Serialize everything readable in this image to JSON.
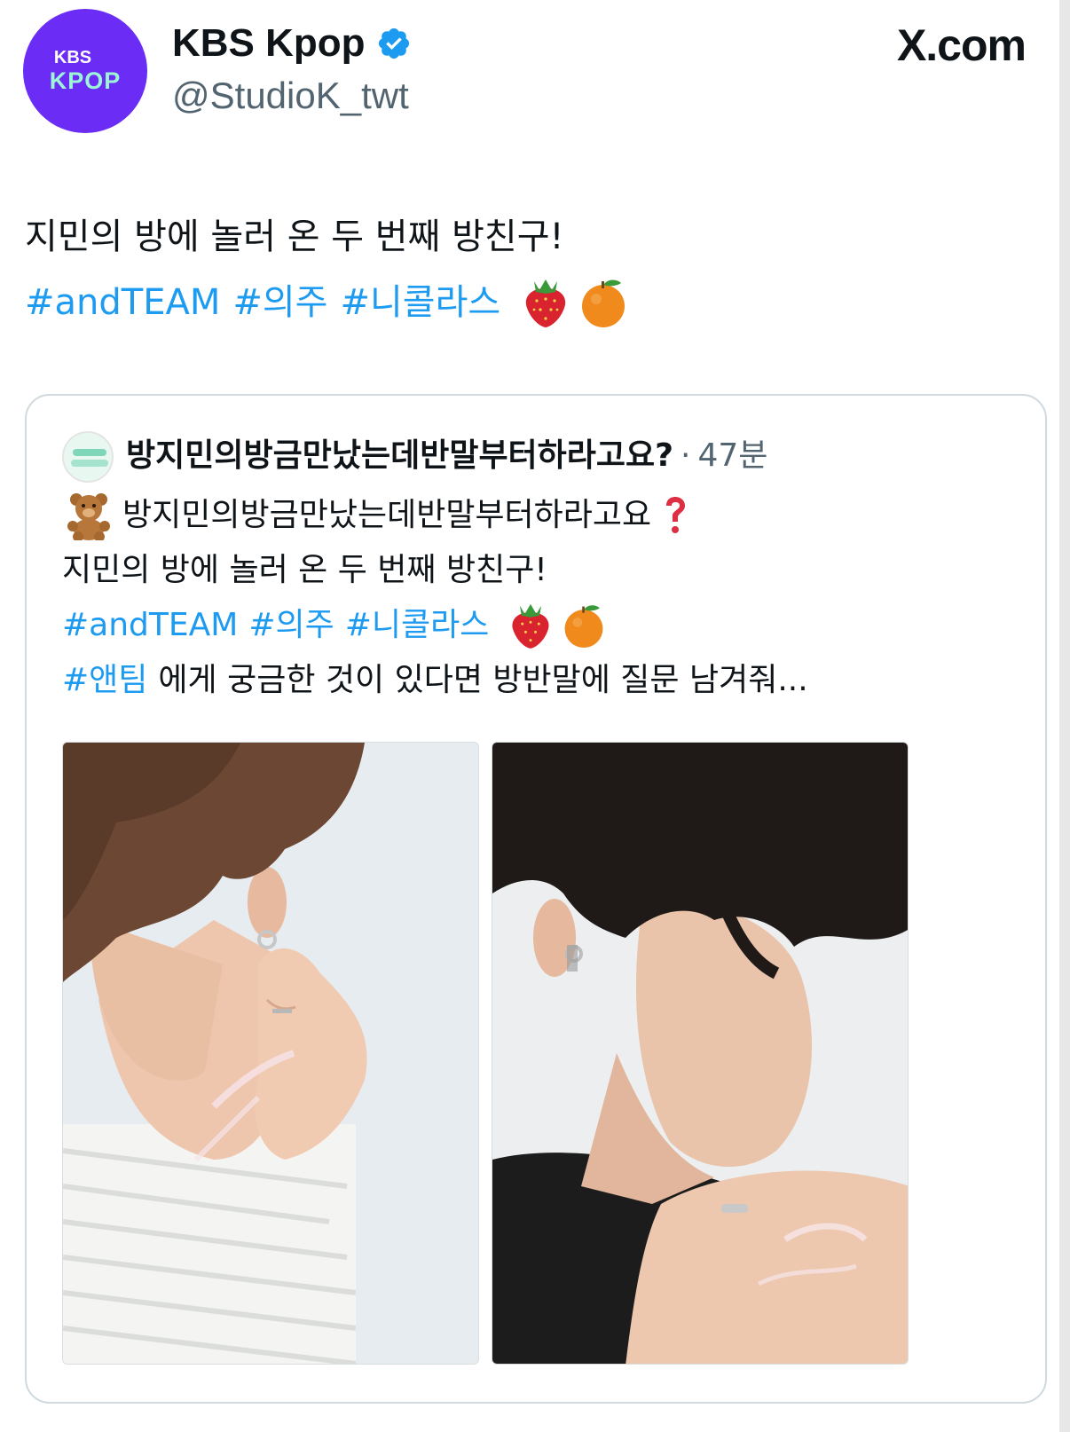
{
  "header": {
    "avatar_line1": "KBS",
    "avatar_line2": "KPOP",
    "display_name": "KBS Kpop",
    "verified_icon": "verified-badge-icon",
    "handle": "@StudioK_twt",
    "site_label": "X.com"
  },
  "tweet": {
    "line1": "지민의 방에 놀러 온 두 번째 방친구!",
    "hashtags": [
      "#andTEAM",
      "#의주",
      "#니콜라스"
    ],
    "emojis": [
      "strawberry-icon",
      "tangerine-icon"
    ]
  },
  "quote": {
    "account_name": "방지민의방금만났는데반말부터하라고요?",
    "separator": "·",
    "time": "47분",
    "line1": "방지민의방금만났는데반말부터하라고요",
    "line1_emojis": [
      "teddy-bear-icon",
      "red-question-mark-icon"
    ],
    "line2": "지민의 방에 놀러 온 두 번째 방친구!",
    "hashtags": [
      "#andTEAM",
      "#의주",
      "#니콜라스"
    ],
    "hashtag_emojis": [
      "strawberry-icon",
      "tangerine-icon"
    ],
    "line4_hashtag": "#앤팀",
    "line4_text": "에게 궁금한 것이 있다면 방반말에 질문 남겨줘..."
  },
  "colors": {
    "link": "#1d9bf0",
    "secondary": "#536471",
    "avatar_bg": "#6b2cf5",
    "avatar_accent": "#9df5d8"
  }
}
